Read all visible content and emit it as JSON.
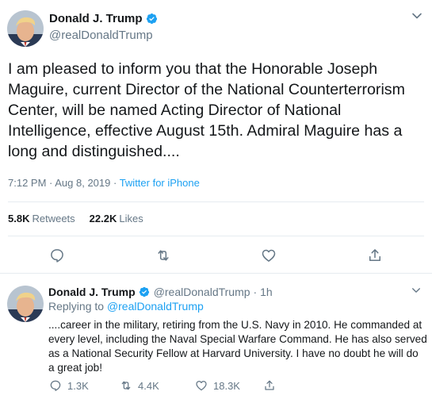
{
  "main_tweet": {
    "display_name": "Donald J. Trump",
    "handle": "@realDonaldTrump",
    "text": "I am pleased to inform you that the Honorable Joseph Maguire, current Director of the National Counterterrorism Center, will be named Acting Director of National Intelligence, effective August 15th. Admiral Maguire has a long and distinguished....",
    "timestamp": "7:12 PM · Aug 8, 2019 · ",
    "source": "Twitter for iPhone",
    "retweets_count": "5.8K",
    "retweets_label": "Retweets",
    "likes_count": "22.2K",
    "likes_label": "Likes",
    "actions": [
      "reply-icon",
      "retweet-icon",
      "like-icon",
      "share-icon"
    ]
  },
  "reply_tweet": {
    "display_name": "Donald J. Trump",
    "handle": "@realDonaldTrump",
    "time_ago": "· 1h",
    "replying_prefix": "Replying to ",
    "replying_to": "@realDonaldTrump",
    "text": "....career in the military, retiring from the U.S. Navy in 2010. He commanded at every level, including the Naval Special Warfare Command. He has also served as a National Security Fellow at Harvard University. I have no doubt he will do a great job!",
    "reply_count": "1.3K",
    "retweet_count": "4.4K",
    "like_count": "18.3K"
  },
  "colors": {
    "accent": "#1da1f2",
    "text": "#14171a",
    "muted": "#657786",
    "divider": "#e6ecf0"
  }
}
